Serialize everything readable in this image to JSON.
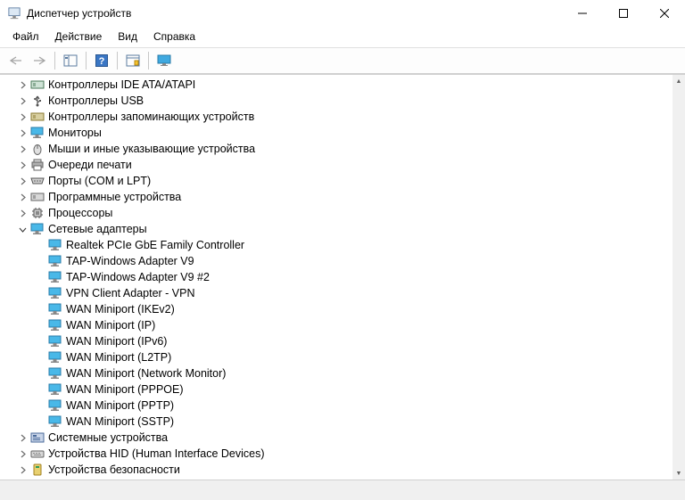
{
  "window": {
    "title": "Диспетчер устройств"
  },
  "menu": {
    "file": "Файл",
    "action": "Действие",
    "view": "Вид",
    "help": "Справка"
  },
  "tree": {
    "categories": [
      {
        "label": "Контроллеры IDE ATA/ATAPI",
        "icon": "ide"
      },
      {
        "label": "Контроллеры USB",
        "icon": "usb"
      },
      {
        "label": "Контроллеры запоминающих устройств",
        "icon": "storage"
      },
      {
        "label": "Мониторы",
        "icon": "monitor"
      },
      {
        "label": "Мыши и иные указывающие устройства",
        "icon": "mouse"
      },
      {
        "label": "Очереди печати",
        "icon": "printer"
      },
      {
        "label": "Порты (COM и LPT)",
        "icon": "port"
      },
      {
        "label": "Программные устройства",
        "icon": "software"
      },
      {
        "label": "Процессоры",
        "icon": "cpu"
      }
    ],
    "network_cat": {
      "label": "Сетевые адаптеры"
    },
    "network_items": [
      {
        "label": "Realtek PCIe GbE Family Controller"
      },
      {
        "label": "TAP-Windows Adapter V9"
      },
      {
        "label": "TAP-Windows Adapter V9 #2"
      },
      {
        "label": "VPN Client Adapter - VPN"
      },
      {
        "label": "WAN Miniport (IKEv2)"
      },
      {
        "label": "WAN Miniport (IP)"
      },
      {
        "label": "WAN Miniport (IPv6)"
      },
      {
        "label": "WAN Miniport (L2TP)"
      },
      {
        "label": "WAN Miniport (Network Monitor)"
      },
      {
        "label": "WAN Miniport (PPPOE)"
      },
      {
        "label": "WAN Miniport (PPTP)"
      },
      {
        "label": "WAN Miniport (SSTP)"
      }
    ],
    "after": [
      {
        "label": "Системные устройства",
        "icon": "system"
      },
      {
        "label": "Устройства HID (Human Interface Devices)",
        "icon": "hid"
      },
      {
        "label": "Устройства безопасности",
        "icon": "security"
      }
    ]
  }
}
